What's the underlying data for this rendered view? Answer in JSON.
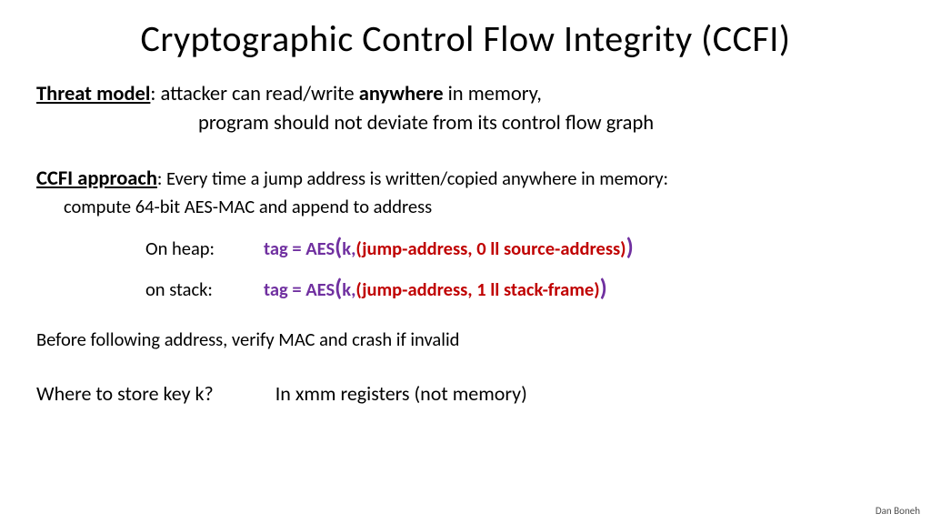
{
  "title": "Cryptographic Control Flow Integrity (CCFI)",
  "threat": {
    "label": "Threat model",
    "line1a": ":   attacker can read/write ",
    "line1b": "anywhere",
    "line1c": " in memory,",
    "line2": "program should not deviate from its control flow graph"
  },
  "ccfi": {
    "label": "CCFI approach",
    "line1": ":   Every time a jump address is written/copied anywhere in memory:",
    "line2": "compute  64-bit  AES-MAC  and append to address",
    "heap": {
      "loc": "On heap:",
      "tag": "tag =  AES",
      "open": "(",
      "k": "k,    ",
      "args": "(jump-address,   0 ll source-address) ",
      "close": ")"
    },
    "stack": {
      "loc": "on stack:",
      "tag": "tag =  AES",
      "open": "(",
      "k": "k,    ",
      "args": "(jump-address,   1 ll stack-frame) ",
      "close": ")"
    }
  },
  "verify": "Before following address,  verify MAC and crash if invalid",
  "storage": {
    "q": "Where to store key k?",
    "a": "In xmm registers   (not memory)"
  },
  "footer": "Dan Boneh"
}
